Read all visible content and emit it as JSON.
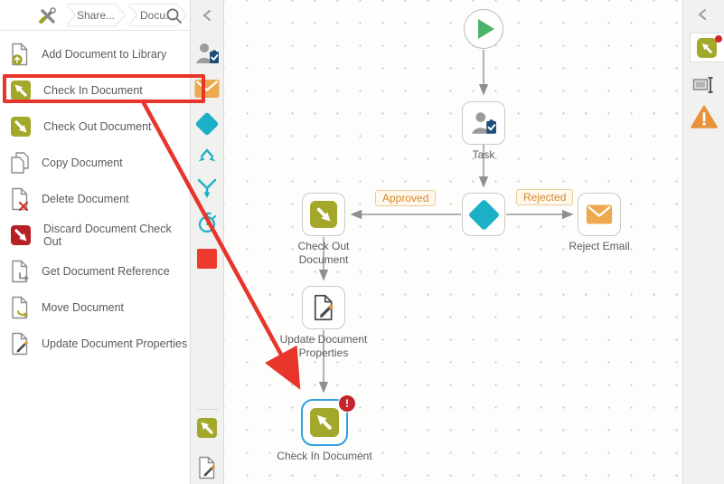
{
  "header": {
    "breadcrumbs": [
      {
        "label": "Share..."
      },
      {
        "label": "Docu..."
      }
    ],
    "tools_icon": "tools-icon",
    "search_icon": "search-icon"
  },
  "action_list": {
    "items": [
      {
        "label": "Add Document to Library",
        "icon": "add-document-icon",
        "highlighted": false
      },
      {
        "label": "Check In Document",
        "icon": "check-in-icon",
        "highlighted": true
      },
      {
        "label": "Check Out Document",
        "icon": "check-out-icon",
        "highlighted": false
      },
      {
        "label": "Copy Document",
        "icon": "copy-document-icon",
        "highlighted": false
      },
      {
        "label": "Delete Document",
        "icon": "delete-document-icon",
        "highlighted": false
      },
      {
        "label": "Discard Document Check Out",
        "icon": "discard-check-out-icon",
        "highlighted": false
      },
      {
        "label": "Get Document Reference",
        "icon": "get-document-reference-icon",
        "highlighted": false
      },
      {
        "label": "Move Document",
        "icon": "move-document-icon",
        "highlighted": false
      },
      {
        "label": "Update Document Properties",
        "icon": "update-document-properties-icon",
        "highlighted": false
      }
    ]
  },
  "toolbar": {
    "icons": [
      "collapse-chevron",
      "user-task-icon",
      "email-icon",
      "decision-icon",
      "split-icon",
      "merge-icon",
      "timer-icon",
      "end-icon"
    ],
    "bottom_icons": [
      "check-in-document-icon",
      "update-document-properties-icon"
    ]
  },
  "canvas": {
    "nodes": [
      {
        "id": "start",
        "type": "start",
        "label": ""
      },
      {
        "id": "task",
        "type": "task",
        "label": "Task"
      },
      {
        "id": "decision",
        "type": "decision",
        "label": ""
      },
      {
        "id": "check-out-document",
        "type": "activity",
        "label": "Check Out Document"
      },
      {
        "id": "reject-email",
        "type": "email",
        "label": "Reject Email"
      },
      {
        "id": "update-document-properties",
        "type": "activity",
        "label": "Update Document Properties"
      },
      {
        "id": "check-in-document",
        "type": "activity",
        "label": "Check In Document",
        "selected": true,
        "has_error": true
      }
    ],
    "edge_labels": {
      "approved": "Approved",
      "rejected": "Rejected"
    },
    "error_badge": "!"
  },
  "right_sidebar": {
    "icons": [
      "collapse-chevron",
      "check-in-document-tab",
      "rename-icon",
      "warnings-icon"
    ],
    "tab_has_alert": true
  },
  "colors": {
    "olive": "#a4a82a",
    "teal": "#1cb0c6",
    "orange": "#eda94f",
    "end_red": "#ee3b30",
    "discard_red": "#b72025",
    "annotation_red": "#e8352c",
    "error_badge_red": "#c5252c",
    "selection_blue": "#2e9fe0",
    "edge_label_orange": "#d68b2e",
    "start_green": "#4db36a",
    "clipboard_blue": "#1d4e79",
    "warning_orange": "#e8923c"
  }
}
